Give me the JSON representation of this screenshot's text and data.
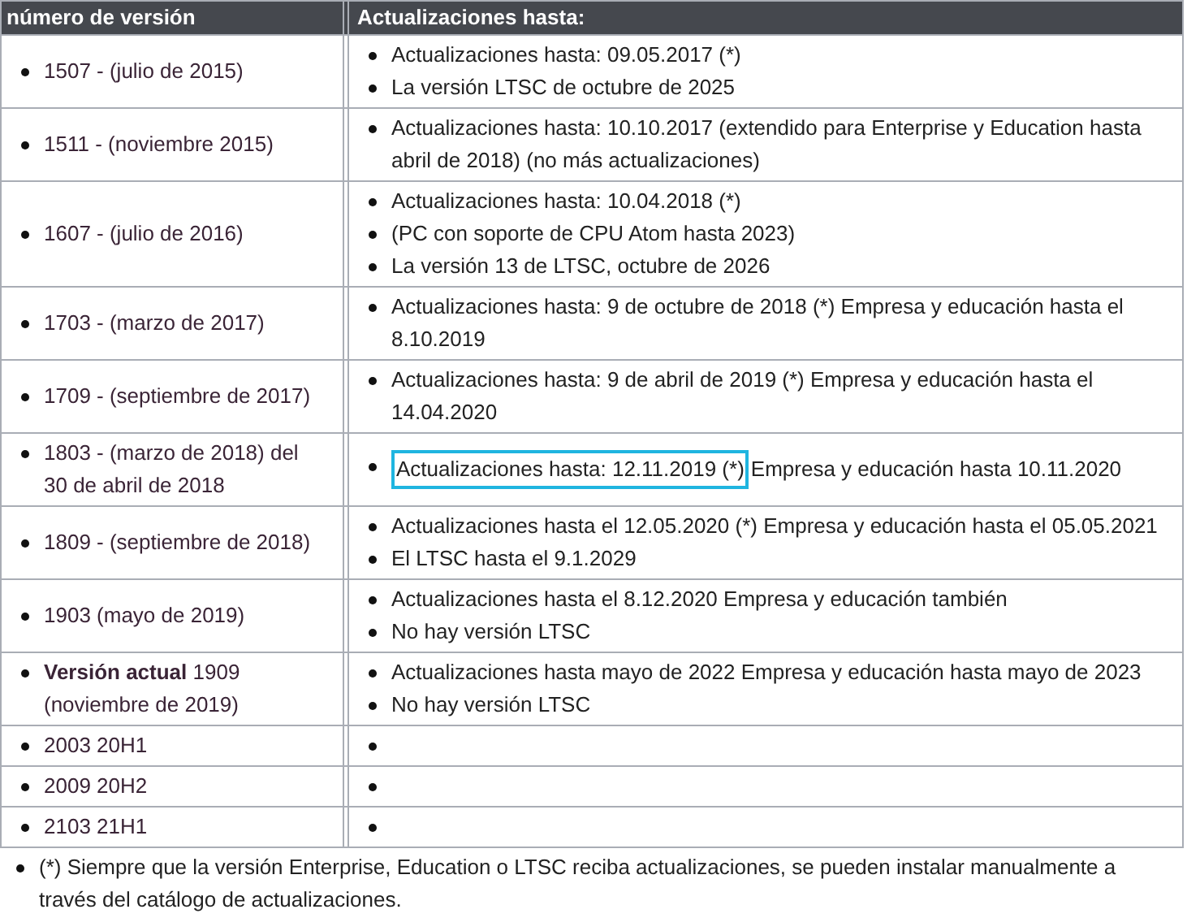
{
  "table": {
    "columns": [
      "número de versión",
      "Actualizaciones hasta:"
    ],
    "rows": [
      {
        "version": "1507 - (julio de 2015)",
        "updates": [
          {
            "kind": "text",
            "text": "Actualizaciones hasta: 09.05.2017 (*)"
          },
          {
            "kind": "text",
            "text": "La versión LTSC de octubre de 2025"
          }
        ]
      },
      {
        "version": "1511 - (noviembre 2015)",
        "updates": [
          {
            "kind": "text",
            "text": "Actualizaciones hasta: 10.10.2017 (extendido para Enterprise y Education hasta abril de 2018) (no más actualizaciones)"
          }
        ]
      },
      {
        "version": "1607 - (julio de 2016)",
        "updates": [
          {
            "kind": "text",
            "text": "Actualizaciones hasta: 10.04.2018 (*)"
          },
          {
            "kind": "text",
            "text": "(PC con soporte de CPU Atom hasta 2023)"
          },
          {
            "kind": "text",
            "text": "La versión 13 de LTSC, octubre de 2026"
          }
        ]
      },
      {
        "version": "1703 - (marzo de 2017)",
        "updates": [
          {
            "kind": "text",
            "text": "Actualizaciones hasta: 9 de octubre de 2018 (*) Empresa y educación hasta el 8.10.2019"
          }
        ]
      },
      {
        "version": "1709 - (septiembre de 2017)",
        "updates": [
          {
            "kind": "text",
            "text": "Actualizaciones hasta: 9 de abril de 2019 (*) Empresa y educación hasta el 14.04.2020"
          }
        ]
      },
      {
        "version": "1803 - (marzo de 2018) del 30 de abril de 2018",
        "updates": [
          {
            "kind": "highlighted",
            "highlight": "Actualizaciones hasta: 12.11.2019 (*)",
            "rest": "Empresa y educación hasta 10.11.2020"
          }
        ]
      },
      {
        "version": "1809 - (septiembre de 2018)",
        "updates": [
          {
            "kind": "text",
            "text": "Actualizaciones hasta el 12.05.2020 (*) Empresa y educación hasta el 05.05.2021"
          },
          {
            "kind": "text",
            "text": "El LTSC hasta el 9.1.2029"
          }
        ]
      },
      {
        "version": "1903 (mayo de 2019)",
        "updates": [
          {
            "kind": "text",
            "text": "Actualizaciones hasta el 8.12.2020 Empresa y educación también"
          },
          {
            "kind": "text",
            "text": "No hay versión LTSC"
          }
        ]
      },
      {
        "version": "**Versión actual** 1909 (noviembre de 2019)",
        "updates": [
          {
            "kind": "text",
            "text": "Actualizaciones hasta mayo de 2022 Empresa y educación hasta mayo de 2023"
          },
          {
            "kind": "text",
            "text": "No hay versión LTSC"
          }
        ]
      },
      {
        "version": "2003 20H1",
        "updates": [
          {
            "kind": "blank"
          }
        ]
      },
      {
        "version": "2009 20H2",
        "updates": [
          {
            "kind": "blank"
          }
        ]
      },
      {
        "version": "2103 21H1",
        "updates": [
          {
            "kind": "blank"
          }
        ]
      }
    ]
  },
  "footnote": "(*) Siempre que la versión Enterprise, Education o LTSC reciba actualizaciones, se pueden instalar manualmente a través del catálogo de actualizaciones."
}
